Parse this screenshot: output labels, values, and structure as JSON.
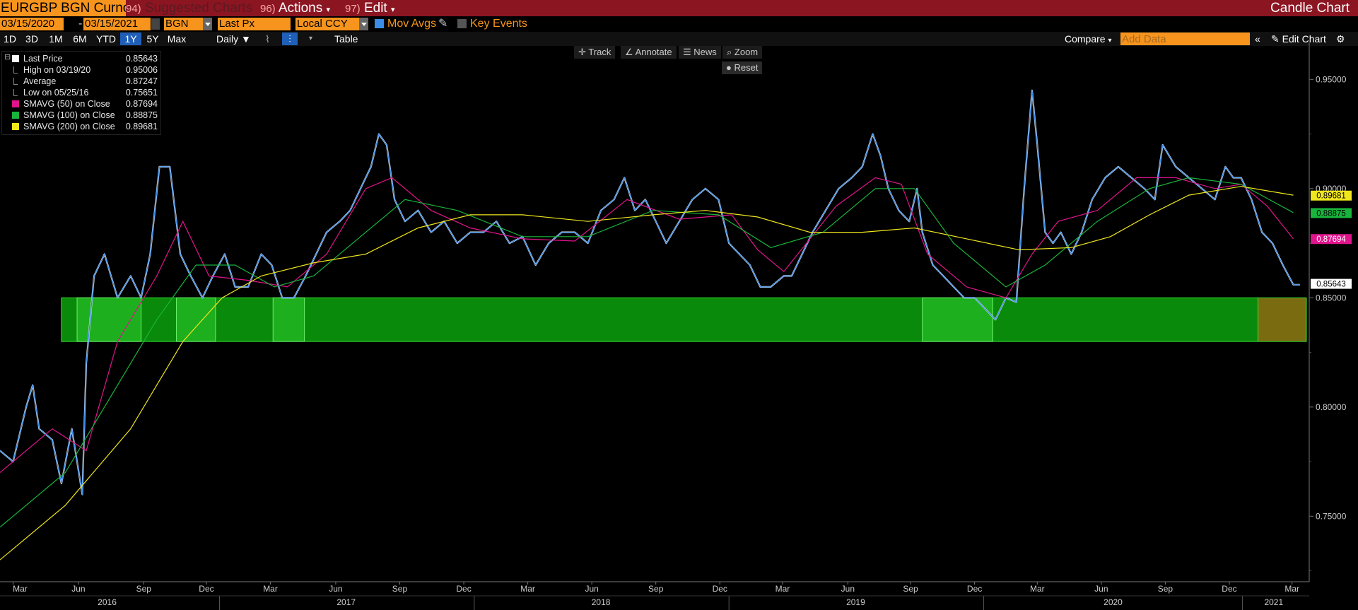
{
  "toolbar": {
    "ticker": "EURGBP BGN Curncy",
    "suggested": {
      "num": "94)",
      "label": "Suggested Charts"
    },
    "actions": {
      "num": "96)",
      "label": "Actions"
    },
    "edit": {
      "num": "97)",
      "label": "Edit"
    },
    "chart_type": "Candle Chart"
  },
  "settings": {
    "start_date": "03/15/2020",
    "sep": "-",
    "end_date": "03/15/2021",
    "source": "BGN",
    "field": "Last Px",
    "currency": "Local CCY",
    "mov_avgs": "Mov Avgs",
    "key_events": "Key Events"
  },
  "periods": [
    "1D",
    "3D",
    "1M",
    "6M",
    "YTD",
    "1Y",
    "5Y",
    "Max"
  ],
  "active_period": "1Y",
  "frequency": "Daily",
  "table_label": "Table",
  "compare_label": "Compare",
  "add_data_placeholder": "Add Data",
  "edit_chart_label": "Edit Chart",
  "tools": {
    "track": "Track",
    "annotate": "Annotate",
    "news": "News",
    "zoom": "Zoom",
    "reset": "Reset"
  },
  "colors": {
    "titlebar": "#8c1522",
    "accent_orange": "#f7941d",
    "price": "#3c8ce7",
    "sma50": "#e0148c",
    "sma100": "#18b43c",
    "sma200": "#f0e61e",
    "band": "#2dcd2d"
  },
  "legend": [
    {
      "name": "Last Price",
      "value": "0.85643",
      "swatch": "#ffffff",
      "icon": "square"
    },
    {
      "name": "High on 03/19/20",
      "value": "0.95006",
      "swatch": "#888888",
      "icon": "high-marker"
    },
    {
      "name": "Average",
      "value": "0.87247",
      "swatch": "#888888",
      "icon": "average-line"
    },
    {
      "name": "Low on 05/25/16",
      "value": "0.75651",
      "swatch": "#888888",
      "icon": "low-marker"
    },
    {
      "name": "SMAVG (50)  on Close",
      "value": "0.87694",
      "swatch": "#e0148c",
      "icon": "square"
    },
    {
      "name": "SMAVG (100)  on Close",
      "value": "0.88875",
      "swatch": "#18b43c",
      "icon": "square"
    },
    {
      "name": "SMAVG (200)  on Close",
      "value": "0.89681",
      "swatch": "#f0e61e",
      "icon": "square"
    }
  ],
  "chart_data": {
    "type": "line",
    "ylim": [
      0.72,
      0.965
    ],
    "yticks": [
      0.75,
      0.8,
      0.85,
      0.9,
      0.95
    ],
    "ytick_labels": [
      "0.75000",
      "0.80000",
      "0.85000",
      "0.90000",
      "0.95000"
    ],
    "x_month_ticks": [
      {
        "label": "Mar",
        "t": 0.01
      },
      {
        "label": "Jun",
        "t": 0.06
      },
      {
        "label": "Sep",
        "t": 0.11
      },
      {
        "label": "Dec",
        "t": 0.158
      },
      {
        "label": "Mar",
        "t": 0.207
      },
      {
        "label": "Jun",
        "t": 0.257
      },
      {
        "label": "Sep",
        "t": 0.306
      },
      {
        "label": "Dec",
        "t": 0.355
      },
      {
        "label": "Mar",
        "t": 0.404
      },
      {
        "label": "Jun",
        "t": 0.453
      },
      {
        "label": "Sep",
        "t": 0.502
      },
      {
        "label": "Dec",
        "t": 0.551
      },
      {
        "label": "Mar",
        "t": 0.599
      },
      {
        "label": "Jun",
        "t": 0.649
      },
      {
        "label": "Sep",
        "t": 0.697
      },
      {
        "label": "Dec",
        "t": 0.746
      },
      {
        "label": "Mar",
        "t": 0.794
      },
      {
        "label": "Jun",
        "t": 0.843
      },
      {
        "label": "Sep",
        "t": 0.892
      },
      {
        "label": "Dec",
        "t": 0.941
      },
      {
        "label": "Mar",
        "t": 0.989
      }
    ],
    "x_year_labels": [
      {
        "label": "2016",
        "t": 0.082
      },
      {
        "label": "2017",
        "t": 0.265
      },
      {
        "label": "2018",
        "t": 0.46
      },
      {
        "label": "2019",
        "t": 0.655
      },
      {
        "label": "2020",
        "t": 0.852
      },
      {
        "label": "2021",
        "t": 0.975
      }
    ],
    "x_year_dividers": [
      0.168,
      0.363,
      0.558,
      0.753,
      0.951
    ],
    "series": [
      {
        "name": "Last Price",
        "color": "#3c8ce7",
        "points": [
          [
            0.0,
            0.78
          ],
          [
            0.01,
            0.775
          ],
          [
            0.02,
            0.8
          ],
          [
            0.025,
            0.81
          ],
          [
            0.03,
            0.79
          ],
          [
            0.04,
            0.785
          ],
          [
            0.047,
            0.765
          ],
          [
            0.055,
            0.79
          ],
          [
            0.063,
            0.76
          ],
          [
            0.066,
            0.82
          ],
          [
            0.072,
            0.86
          ],
          [
            0.08,
            0.87
          ],
          [
            0.09,
            0.85
          ],
          [
            0.1,
            0.86
          ],
          [
            0.108,
            0.85
          ],
          [
            0.115,
            0.87
          ],
          [
            0.122,
            0.91
          ],
          [
            0.13,
            0.91
          ],
          [
            0.138,
            0.87
          ],
          [
            0.146,
            0.86
          ],
          [
            0.155,
            0.85
          ],
          [
            0.163,
            0.86
          ],
          [
            0.172,
            0.87
          ],
          [
            0.18,
            0.855
          ],
          [
            0.19,
            0.855
          ],
          [
            0.2,
            0.87
          ],
          [
            0.208,
            0.865
          ],
          [
            0.216,
            0.85
          ],
          [
            0.225,
            0.85
          ],
          [
            0.234,
            0.86
          ],
          [
            0.242,
            0.87
          ],
          [
            0.25,
            0.88
          ],
          [
            0.26,
            0.885
          ],
          [
            0.268,
            0.89
          ],
          [
            0.276,
            0.9
          ],
          [
            0.284,
            0.91
          ],
          [
            0.29,
            0.925
          ],
          [
            0.296,
            0.92
          ],
          [
            0.302,
            0.895
          ],
          [
            0.31,
            0.885
          ],
          [
            0.32,
            0.89
          ],
          [
            0.33,
            0.88
          ],
          [
            0.34,
            0.885
          ],
          [
            0.35,
            0.875
          ],
          [
            0.36,
            0.88
          ],
          [
            0.37,
            0.88
          ],
          [
            0.38,
            0.885
          ],
          [
            0.39,
            0.875
          ],
          [
            0.4,
            0.878
          ],
          [
            0.41,
            0.865
          ],
          [
            0.42,
            0.875
          ],
          [
            0.43,
            0.88
          ],
          [
            0.44,
            0.88
          ],
          [
            0.45,
            0.875
          ],
          [
            0.46,
            0.89
          ],
          [
            0.47,
            0.895
          ],
          [
            0.478,
            0.905
          ],
          [
            0.486,
            0.89
          ],
          [
            0.494,
            0.895
          ],
          [
            0.502,
            0.885
          ],
          [
            0.51,
            0.875
          ],
          [
            0.52,
            0.885
          ],
          [
            0.53,
            0.895
          ],
          [
            0.54,
            0.9
          ],
          [
            0.55,
            0.895
          ],
          [
            0.558,
            0.875
          ],
          [
            0.566,
            0.87
          ],
          [
            0.574,
            0.865
          ],
          [
            0.582,
            0.855
          ],
          [
            0.59,
            0.855
          ],
          [
            0.6,
            0.86
          ],
          [
            0.606,
            0.86
          ],
          [
            0.614,
            0.87
          ],
          [
            0.622,
            0.88
          ],
          [
            0.632,
            0.89
          ],
          [
            0.642,
            0.9
          ],
          [
            0.652,
            0.905
          ],
          [
            0.66,
            0.91
          ],
          [
            0.668,
            0.925
          ],
          [
            0.674,
            0.915
          ],
          [
            0.68,
            0.9
          ],
          [
            0.688,
            0.89
          ],
          [
            0.696,
            0.885
          ],
          [
            0.702,
            0.9
          ],
          [
            0.706,
            0.88
          ],
          [
            0.714,
            0.865
          ],
          [
            0.722,
            0.86
          ],
          [
            0.73,
            0.855
          ],
          [
            0.738,
            0.85
          ],
          [
            0.746,
            0.85
          ],
          [
            0.754,
            0.845
          ],
          [
            0.762,
            0.84
          ],
          [
            0.77,
            0.85
          ],
          [
            0.778,
            0.848
          ],
          [
            0.784,
            0.9
          ],
          [
            0.79,
            0.945
          ],
          [
            0.794,
            0.92
          ],
          [
            0.8,
            0.88
          ],
          [
            0.806,
            0.875
          ],
          [
            0.812,
            0.88
          ],
          [
            0.82,
            0.87
          ],
          [
            0.828,
            0.88
          ],
          [
            0.836,
            0.895
          ],
          [
            0.846,
            0.905
          ],
          [
            0.856,
            0.91
          ],
          [
            0.866,
            0.905
          ],
          [
            0.876,
            0.9
          ],
          [
            0.884,
            0.895
          ],
          [
            0.89,
            0.92
          ],
          [
            0.9,
            0.91
          ],
          [
            0.91,
            0.905
          ],
          [
            0.92,
            0.9
          ],
          [
            0.93,
            0.895
          ],
          [
            0.938,
            0.91
          ],
          [
            0.944,
            0.905
          ],
          [
            0.95,
            0.905
          ],
          [
            0.958,
            0.895
          ],
          [
            0.966,
            0.88
          ],
          [
            0.974,
            0.875
          ],
          [
            0.982,
            0.865
          ],
          [
            0.99,
            0.856
          ],
          [
            0.995,
            0.856
          ]
        ]
      },
      {
        "name": "SMAVG (50)  on Close",
        "color": "#e0148c",
        "points": [
          [
            0.0,
            0.77
          ],
          [
            0.04,
            0.79
          ],
          [
            0.066,
            0.78
          ],
          [
            0.09,
            0.83
          ],
          [
            0.12,
            0.86
          ],
          [
            0.14,
            0.885
          ],
          [
            0.16,
            0.86
          ],
          [
            0.19,
            0.858
          ],
          [
            0.22,
            0.855
          ],
          [
            0.25,
            0.87
          ],
          [
            0.28,
            0.9
          ],
          [
            0.3,
            0.905
          ],
          [
            0.33,
            0.89
          ],
          [
            0.36,
            0.882
          ],
          [
            0.4,
            0.877
          ],
          [
            0.44,
            0.876
          ],
          [
            0.48,
            0.895
          ],
          [
            0.52,
            0.886
          ],
          [
            0.56,
            0.888
          ],
          [
            0.58,
            0.872
          ],
          [
            0.6,
            0.862
          ],
          [
            0.64,
            0.892
          ],
          [
            0.67,
            0.905
          ],
          [
            0.69,
            0.902
          ],
          [
            0.71,
            0.87
          ],
          [
            0.74,
            0.855
          ],
          [
            0.77,
            0.85
          ],
          [
            0.79,
            0.87
          ],
          [
            0.81,
            0.885
          ],
          [
            0.84,
            0.89
          ],
          [
            0.87,
            0.905
          ],
          [
            0.9,
            0.905
          ],
          [
            0.93,
            0.9
          ],
          [
            0.95,
            0.902
          ],
          [
            0.97,
            0.892
          ],
          [
            0.99,
            0.877
          ]
        ]
      },
      {
        "name": "SMAVG (100)  on Close",
        "color": "#18b43c",
        "points": [
          [
            0.0,
            0.745
          ],
          [
            0.05,
            0.77
          ],
          [
            0.08,
            0.8
          ],
          [
            0.12,
            0.84
          ],
          [
            0.15,
            0.865
          ],
          [
            0.18,
            0.865
          ],
          [
            0.21,
            0.855
          ],
          [
            0.24,
            0.86
          ],
          [
            0.28,
            0.88
          ],
          [
            0.31,
            0.895
          ],
          [
            0.35,
            0.89
          ],
          [
            0.4,
            0.878
          ],
          [
            0.45,
            0.878
          ],
          [
            0.5,
            0.89
          ],
          [
            0.55,
            0.888
          ],
          [
            0.59,
            0.873
          ],
          [
            0.63,
            0.88
          ],
          [
            0.67,
            0.9
          ],
          [
            0.7,
            0.9
          ],
          [
            0.73,
            0.875
          ],
          [
            0.77,
            0.855
          ],
          [
            0.8,
            0.865
          ],
          [
            0.84,
            0.885
          ],
          [
            0.88,
            0.9
          ],
          [
            0.91,
            0.905
          ],
          [
            0.95,
            0.902
          ],
          [
            0.99,
            0.889
          ]
        ]
      },
      {
        "name": "SMAVG (200)  on Close",
        "color": "#f0e61e",
        "points": [
          [
            0.0,
            0.73
          ],
          [
            0.05,
            0.755
          ],
          [
            0.1,
            0.79
          ],
          [
            0.14,
            0.83
          ],
          [
            0.17,
            0.85
          ],
          [
            0.2,
            0.86
          ],
          [
            0.24,
            0.866
          ],
          [
            0.28,
            0.87
          ],
          [
            0.32,
            0.882
          ],
          [
            0.36,
            0.888
          ],
          [
            0.4,
            0.888
          ],
          [
            0.45,
            0.885
          ],
          [
            0.5,
            0.888
          ],
          [
            0.54,
            0.89
          ],
          [
            0.58,
            0.887
          ],
          [
            0.62,
            0.88
          ],
          [
            0.66,
            0.88
          ],
          [
            0.7,
            0.882
          ],
          [
            0.74,
            0.877
          ],
          [
            0.78,
            0.872
          ],
          [
            0.82,
            0.873
          ],
          [
            0.85,
            0.878
          ],
          [
            0.88,
            0.888
          ],
          [
            0.91,
            0.897
          ],
          [
            0.95,
            0.901
          ],
          [
            0.99,
            0.897
          ]
        ]
      }
    ],
    "band": {
      "y_low": 0.83,
      "y_high": 0.85,
      "t_start": 0.047,
      "t_end": 0.963,
      "end_color": "#7a6a10",
      "highlights": [
        [
          0.059,
          0.108
        ],
        [
          0.135,
          0.165
        ],
        [
          0.209,
          0.233
        ],
        [
          0.706,
          0.76
        ]
      ]
    },
    "last_value_tags": [
      {
        "label": "0.89681",
        "value": 0.8968,
        "bg": "#f0e61e",
        "fg": "#000"
      },
      {
        "label": "0.88875",
        "value": 0.8888,
        "bg": "#18b43c",
        "fg": "#000"
      },
      {
        "label": "0.87694",
        "value": 0.8769,
        "bg": "#e0148c",
        "fg": "#fff"
      },
      {
        "label": "0.85643",
        "value": 0.8564,
        "bg": "#ffffff",
        "fg": "#000"
      }
    ]
  }
}
